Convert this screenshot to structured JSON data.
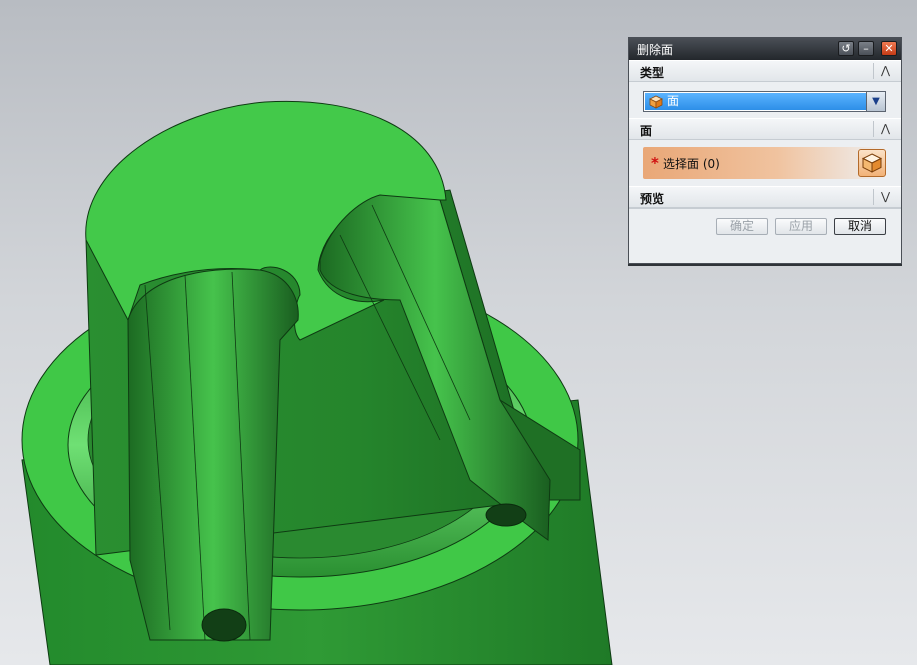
{
  "dialog": {
    "title": "删除面",
    "titlebar_buttons": [
      "reset-icon",
      "minimize-icon",
      "close-icon"
    ],
    "sections": {
      "type": {
        "label": "类型",
        "collapsed": false
      },
      "face": {
        "label": "面",
        "collapsed": false
      },
      "preview": {
        "label": "预览",
        "collapsed": true
      }
    },
    "type_select": {
      "value": "面",
      "icon": "face-cube-icon"
    },
    "select_face": {
      "required_marker": "*",
      "label": "选择面 (0)",
      "icon": "select-face-cube-icon"
    },
    "buttons": {
      "ok": "确定",
      "apply": "应用",
      "cancel": "取消"
    }
  },
  "colors": {
    "model_light": "#43c94a",
    "model_dark": "#1f7a27",
    "selection_highlight": "#2d8fe8",
    "required_field": "#e9a777"
  }
}
